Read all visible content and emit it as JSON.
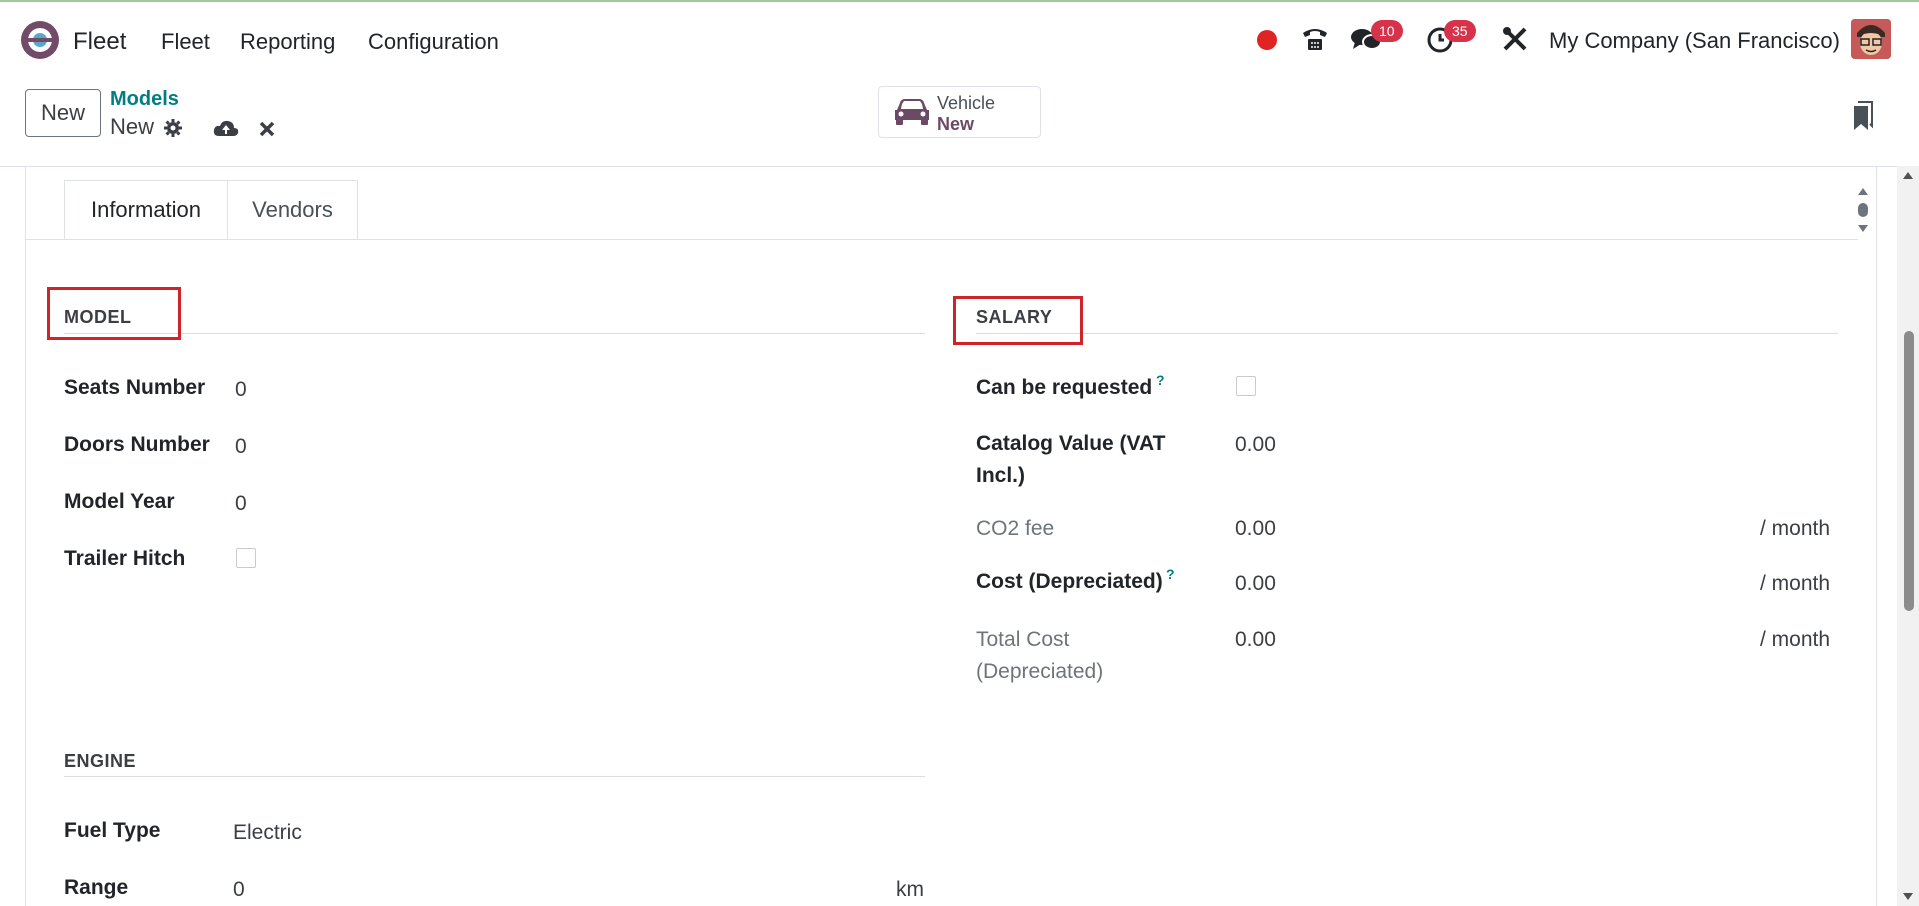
{
  "navbar": {
    "app_name": "Fleet",
    "menu": [
      "Fleet",
      "Reporting",
      "Configuration"
    ],
    "messages_badge": "10",
    "activities_badge": "35",
    "company": "My Company (San Francisco)"
  },
  "control": {
    "new_button": "New",
    "breadcrumb_parent": "Models",
    "breadcrumb_current": "New",
    "smart_button": {
      "label": "Vehicle",
      "value": "New"
    }
  },
  "tabs": [
    "Information",
    "Vendors"
  ],
  "model_section": {
    "title": "MODEL",
    "fields": [
      {
        "label": "Seats Number",
        "value": "0"
      },
      {
        "label": "Doors Number",
        "value": "0"
      },
      {
        "label": "Model Year",
        "value": "0"
      },
      {
        "label": "Trailer Hitch",
        "value": ""
      }
    ]
  },
  "engine_section": {
    "title": "ENGINE",
    "fields": [
      {
        "label": "Fuel Type",
        "value": "Electric"
      },
      {
        "label": "Range",
        "value": "0",
        "unit": "km"
      }
    ]
  },
  "salary_section": {
    "title": "SALARY",
    "fields": [
      {
        "label": "Can be requested",
        "help": "?"
      },
      {
        "label_line1": "Catalog Value (VAT",
        "label_line2": "Incl.)",
        "value": "0.00"
      },
      {
        "label": "CO2 fee",
        "value": "0.00",
        "unit": "/ month"
      },
      {
        "label": "Cost (Depreciated)",
        "help": "?",
        "value": "0.00",
        "unit": "/ month"
      },
      {
        "label_line1": "Total Cost",
        "label_line2": "(Depreciated)",
        "value": "0.00",
        "unit": "/ month"
      }
    ]
  },
  "colors": {
    "accent_teal": "#017e84",
    "brand_purple": "#714b67",
    "badge_red": "#d6334b",
    "highlight_red": "#d0242b"
  },
  "icons": [
    "fleet-logo-icon",
    "record-dot-icon",
    "phone-icon",
    "chat-icon",
    "clock-icon",
    "tools-icon",
    "gear-icon",
    "cloud-upload-icon",
    "close-icon",
    "car-icon",
    "bookmark-icon"
  ]
}
